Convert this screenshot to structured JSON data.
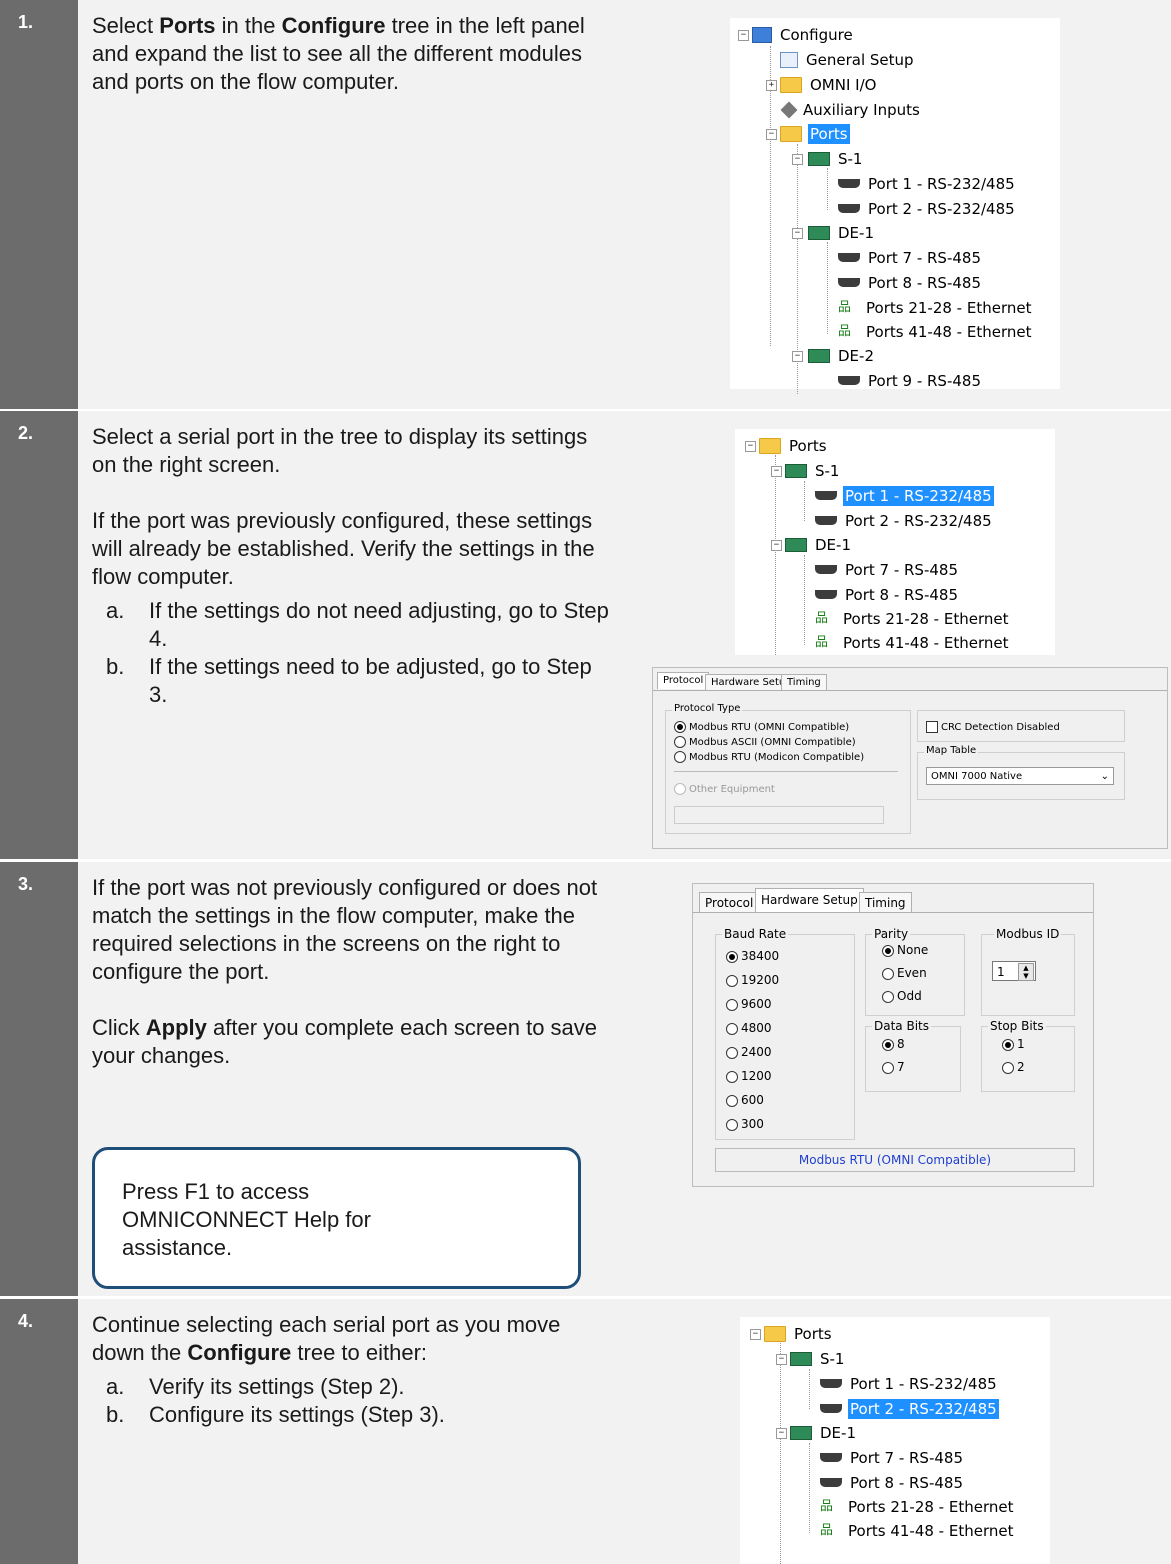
{
  "steps": [
    {
      "number": "1.",
      "text_parts": [
        "Select ",
        "Ports",
        " in the ",
        "Configure",
        " tree in the left panel and expand the list to see all the different modules and ports on the flow computer."
      ]
    },
    {
      "number": "2.",
      "intro": "Select a serial port in the tree to display its settings on the right screen.",
      "para2": "If the port was previously configured, these settings will already be established. Verify the settings in the flow computer.",
      "items": [
        {
          "letter": "a.",
          "text": "If the settings do not need adjusting, go to Step 4."
        },
        {
          "letter": "b.",
          "text": "If the settings need to be adjusted, go to Step 3."
        }
      ]
    },
    {
      "number": "3.",
      "intro": "If the port was not previously configured or does not match the settings in the flow computer, make the required selections in the screens on the right to configure the port.",
      "apply_parts": [
        "Click ",
        "Apply",
        " after you complete each screen to save your changes."
      ],
      "note": "Press F1 to access OMNICONNECT Help for assistance."
    },
    {
      "number": "4.",
      "text_parts": [
        "Continue selecting each serial port as you move down the ",
        "Configure",
        " tree to either:"
      ],
      "items": [
        {
          "letter": "a.",
          "text": "Verify its settings (Step 2)."
        },
        {
          "letter": "b.",
          "text": "Configure its settings (Step 3)."
        }
      ]
    }
  ],
  "tree1": {
    "configure": "Configure",
    "general": "General Setup",
    "omni_io": "OMNI I/O",
    "aux": "Auxiliary Inputs",
    "ports": "Ports",
    "s1": "S-1",
    "p1": "Port 1 - RS-232/485",
    "p2": "Port 2 - RS-232/485",
    "de1": "DE-1",
    "p7": "Port 7 - RS-485",
    "p8": "Port 8 - RS-485",
    "p21": "Ports 21-28 - Ethernet",
    "p41": "Ports 41-48 - Ethernet",
    "de2": "DE-2",
    "p9": "Port 9 - RS-485"
  },
  "protocol_dialog": {
    "tabs": [
      "Protocol",
      "Hardware Setup",
      "Timing"
    ],
    "group_protocol": "Protocol Type",
    "options": [
      "Modbus RTU (OMNI Compatible)",
      "Modbus ASCII (OMNI Compatible)",
      "Modbus RTU (Modicon Compatible)"
    ],
    "other": "Other Equipment",
    "crc": "CRC Detection Disabled",
    "map_group": "Map Table",
    "map_value": "OMNI 7000 Native"
  },
  "hardware_dialog": {
    "tabs": [
      "Protocol",
      "Hardware Setup",
      "Timing"
    ],
    "baud_label": "Baud Rate",
    "bauds": [
      "38400",
      "19200",
      "9600",
      "4800",
      "2400",
      "1200",
      "600",
      "300"
    ],
    "parity_label": "Parity",
    "parities": [
      "None",
      "Even",
      "Odd"
    ],
    "modbus_label": "Modbus ID",
    "modbus_value": "1",
    "data_label": "Data Bits",
    "data": [
      "8",
      "7"
    ],
    "stop_label": "Stop Bits",
    "stop": [
      "1",
      "2"
    ],
    "status": "Modbus RTU (OMNI Compatible)"
  }
}
